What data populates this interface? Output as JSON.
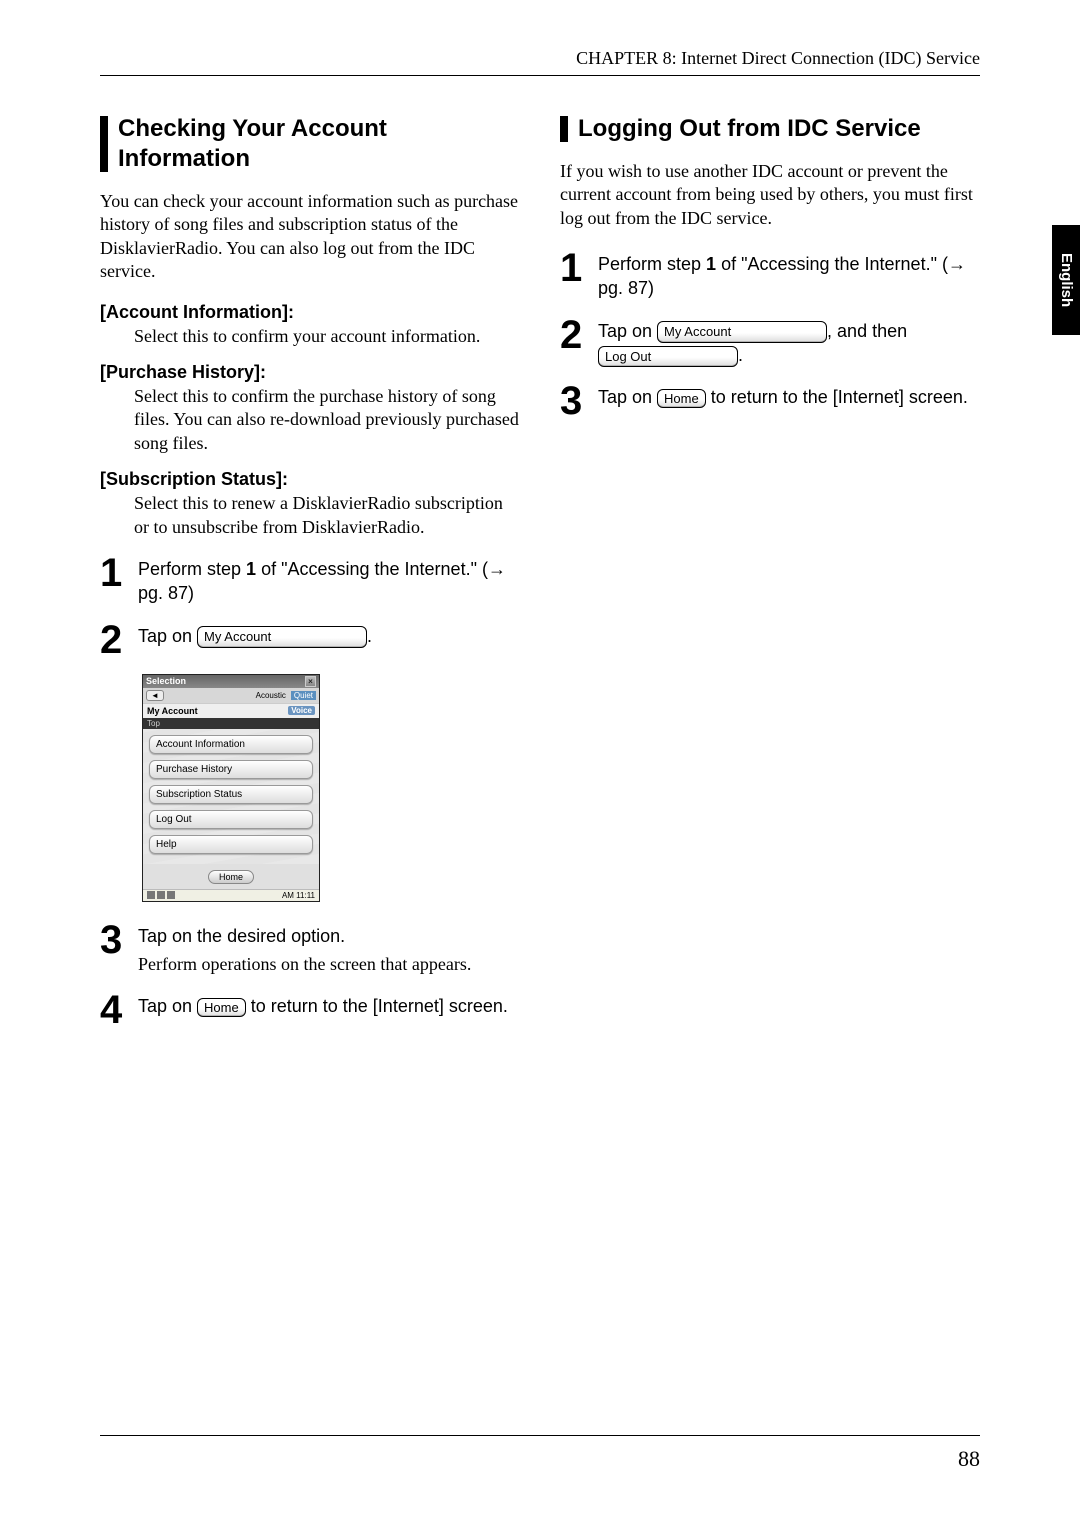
{
  "chapter_header": "CHAPTER 8: Internet Direct Connection (IDC) Service",
  "side_tab": "English",
  "page_number": "88",
  "left": {
    "heading": "Checking Your Account Information",
    "intro": "You can check your account information such as purchase history of song files and subscription status of the DisklavierRadio. You can also log out from the IDC service.",
    "defs": [
      {
        "head": "[Account Information]:",
        "body": "Select this to confirm your account information."
      },
      {
        "head": "[Purchase History]:",
        "body": "Select this to confirm the purchase history of song files. You can also re-download previously purchased song files."
      },
      {
        "head": "[Subscription Status]:",
        "body": "Select this to renew a DisklavierRadio subscription or to unsubscribe from DisklavierRadio."
      }
    ],
    "steps": {
      "s1_a": "Perform step ",
      "s1_bold": "1",
      "s1_b": " of \"Accessing the Internet.\" (",
      "s1_arrow": "→",
      "s1_c": " pg. 87)",
      "s2_a": "Tap on ",
      "s2_btn": "My Account",
      "s2_b": ".",
      "s3_a": "Tap on the desired option.",
      "s3_sub": "Perform operations on the screen that appears.",
      "s4_a": "Tap on ",
      "s4_btn": "Home",
      "s4_b": " to return to the [Internet] screen."
    },
    "screenshot": {
      "title": "Selection",
      "back": "◄",
      "tab1": "Acoustic",
      "tab2": "Quiet",
      "header2": "My Account",
      "voice": "Voice",
      "darkbar": "Top",
      "items": [
        "Account Information",
        "Purchase History",
        "Subscription Status",
        "Log Out",
        "Help"
      ],
      "home": "Home",
      "footer_time": "AM 11:11"
    }
  },
  "right": {
    "heading": "Logging Out from IDC Service",
    "intro": "If you wish to use another IDC account or prevent the current account from being used by others, you must first log out from the IDC service.",
    "steps": {
      "s1_a": "Perform step ",
      "s1_bold": "1",
      "s1_b": " of \"Accessing the Internet.\" (",
      "s1_arrow": "→",
      "s1_c": " pg. 87)",
      "s2_a": "Tap on ",
      "s2_btn1": "My Account",
      "s2_mid": ", and then ",
      "s2_btn2": "Log Out",
      "s2_b": ".",
      "s3_a": "Tap on ",
      "s3_btn": "Home",
      "s3_b": " to return to the [Internet] screen."
    }
  }
}
